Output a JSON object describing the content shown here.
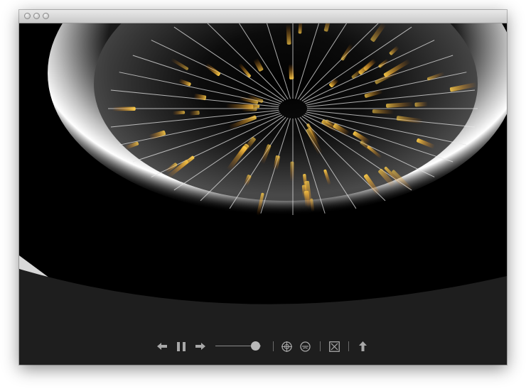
{
  "window": {
    "title": "",
    "traffic_lights": [
      "close",
      "minimize",
      "zoom"
    ]
  },
  "visualization": {
    "description_icon": "orbital-wireframe-icon",
    "colors": {
      "background": "#000000",
      "panel": "#1e1e1e",
      "glow": "#ffffff",
      "sparks": "#f5a623"
    }
  },
  "controls": {
    "previous_icon": "arrow-left-icon",
    "pause_icon": "pause-icon",
    "next_icon": "arrow-right-icon",
    "volume_level": 0.88,
    "crosshair_icon": "crosshair-icon",
    "smiley_icon": "smiley-face-icon",
    "exit_fullscreen_icon": "box-x-icon",
    "eject_icon": "arrow-up-icon",
    "color": "#a8a8a8"
  }
}
